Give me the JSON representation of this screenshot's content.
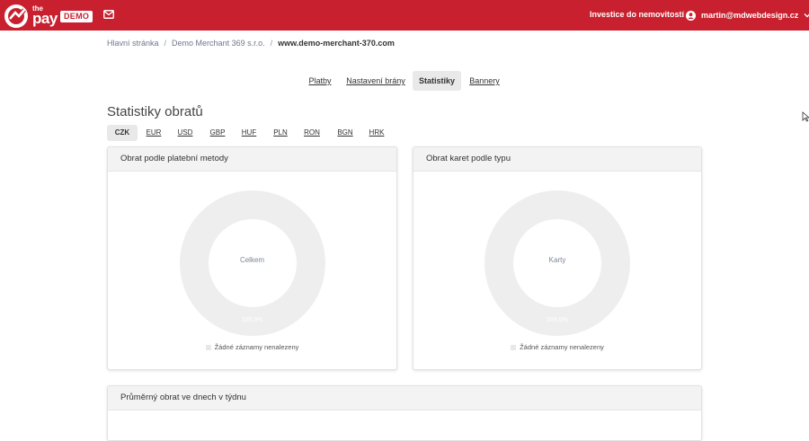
{
  "header": {
    "logo_top": "the",
    "logo_main": "pay",
    "demo_badge": "DEMO",
    "nav_link": "Investice do nemovitostí",
    "user_email": "martin@mdwebdesign.cz",
    "brand_color": "#c8202e"
  },
  "breadcrumb": {
    "items": [
      "Hlavní stránka",
      "Demo Merchant 369 s.r.o.",
      "www.demo-merchant-370.com"
    ],
    "separator": "/"
  },
  "tabs": [
    "Platby",
    "Nastavení brány",
    "Statistiky",
    "Bannery"
  ],
  "active_tab": "Statistiky",
  "section_title": "Statistiky obratů",
  "currencies": [
    "CZK",
    "EUR",
    "USD",
    "GBP",
    "HUF",
    "PLN",
    "RON",
    "BGN",
    "HRK"
  ],
  "active_currency": "CZK",
  "cards": [
    {
      "title": "Obrat podle platební metody",
      "center_label": "Celkem",
      "percent_label": "100.0%",
      "legend": "Žádné záznamy nenalezeny"
    },
    {
      "title": "Obrat karet podle typu",
      "center_label": "Karty",
      "percent_label": "100.0%",
      "legend": "Žádné záznamy nenalezeny"
    }
  ],
  "bottom_card_title": "Průměrný obrat ve dnech v týdnu",
  "icons": {
    "logo": "thepay-logo-icon",
    "mail": "mail-icon",
    "user": "user-icon",
    "chevron": "chevron-down-icon"
  }
}
